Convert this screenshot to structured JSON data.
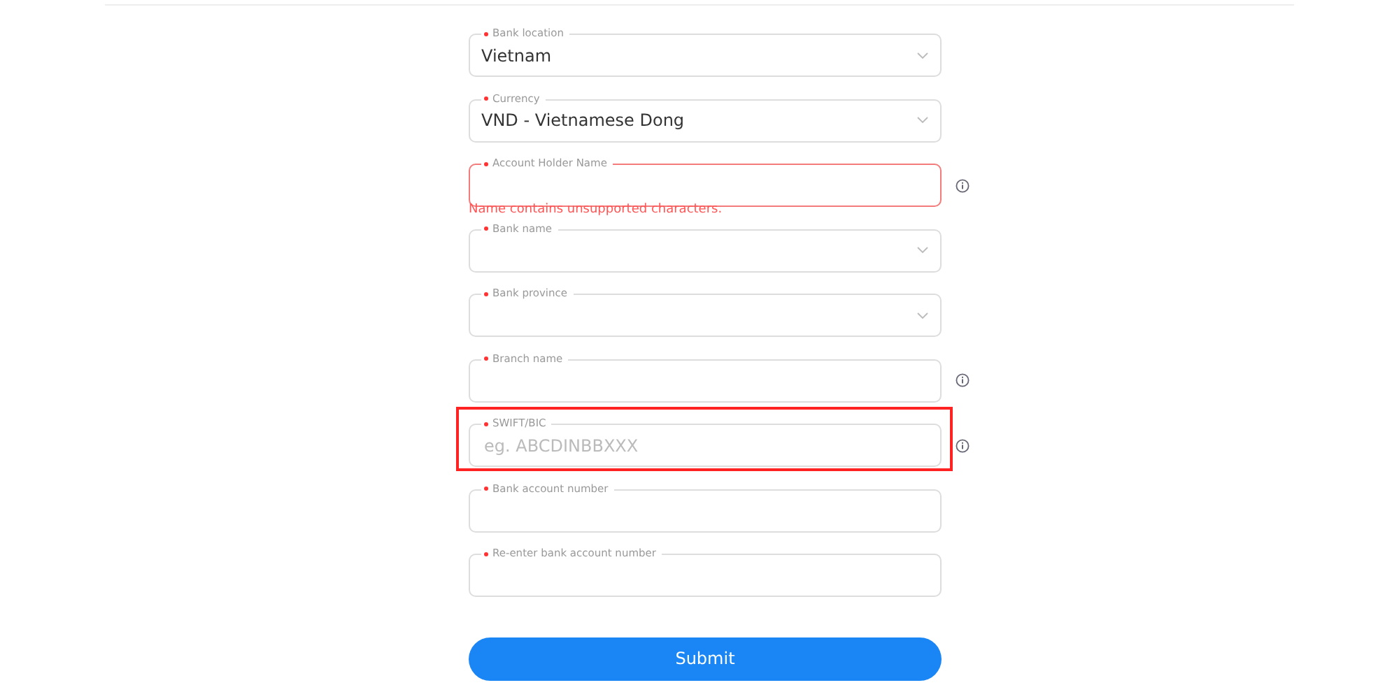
{
  "fields": [
    {
      "kind": "select",
      "label": "Bank location",
      "required": true,
      "value": "Vietnam",
      "invalid": false,
      "info": false,
      "highlighted": false
    },
    {
      "kind": "select",
      "label": "Currency",
      "required": true,
      "value": "VND - Vietnamese Dong",
      "invalid": false,
      "info": false,
      "highlighted": false
    },
    {
      "kind": "text",
      "label": "Account Holder Name",
      "required": true,
      "invalid": true,
      "error": "Name contains unsupported characters.",
      "info": true,
      "highlighted": false
    },
    {
      "kind": "select",
      "label": "Bank name",
      "required": true,
      "invalid": false,
      "info": false,
      "highlighted": false
    },
    {
      "kind": "select",
      "label": "Bank province",
      "required": true,
      "invalid": false,
      "info": false,
      "highlighted": false
    },
    {
      "kind": "text",
      "label": "Branch name",
      "required": true,
      "invalid": false,
      "info": true,
      "highlighted": false
    },
    {
      "kind": "text",
      "label": "SWIFT/BIC",
      "required": true,
      "placeholder": "eg. ABCDINBBXXX",
      "invalid": false,
      "info": true,
      "highlighted": true
    },
    {
      "kind": "text",
      "label": "Bank account number",
      "required": true,
      "invalid": false,
      "info": false,
      "highlighted": false
    },
    {
      "kind": "text",
      "label": "Re-enter bank account number",
      "required": true,
      "invalid": false,
      "info": false,
      "highlighted": false
    }
  ],
  "submit": {
    "label": "Submit"
  }
}
